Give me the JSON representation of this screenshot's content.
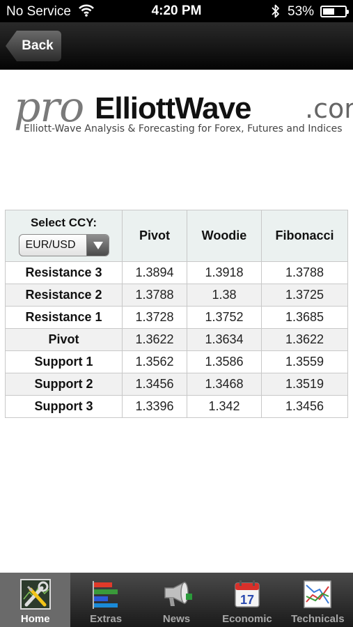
{
  "status_bar": {
    "carrier": "No Service",
    "time": "4:20 PM",
    "battery_percent": "53%",
    "battery_level": 0.53,
    "icons": [
      "wifi-icon",
      "bluetooth-icon",
      "battery-icon"
    ]
  },
  "nav": {
    "back_label": "Back"
  },
  "logo": {
    "pro": "pro",
    "brand": "ElliottWave",
    "dotcom": ".com",
    "tagline": "Elliott-Wave Analysis & Forecasting for Forex, Futures and Indices"
  },
  "table": {
    "select_label": "Select CCY:",
    "selected_ccy": "EUR/USD",
    "columns": [
      "Pivot",
      "Woodie",
      "Fibonacci"
    ],
    "rows": [
      {
        "label": "Resistance 3",
        "values": [
          "1.3894",
          "1.3918",
          "1.3788"
        ]
      },
      {
        "label": "Resistance 2",
        "values": [
          "1.3788",
          "1.38",
          "1.3725"
        ]
      },
      {
        "label": "Resistance 1",
        "values": [
          "1.3728",
          "1.3752",
          "1.3685"
        ]
      },
      {
        "label": "Pivot",
        "values": [
          "1.3622",
          "1.3634",
          "1.3622"
        ]
      },
      {
        "label": "Support 1",
        "values": [
          "1.3562",
          "1.3586",
          "1.3559"
        ]
      },
      {
        "label": "Support 2",
        "values": [
          "1.3456",
          "1.3468",
          "1.3519"
        ]
      },
      {
        "label": "Support 3",
        "values": [
          "1.3396",
          "1.342",
          "1.3456"
        ]
      }
    ]
  },
  "tabs": [
    {
      "label": "Home",
      "icon": "tools-icon",
      "active": true
    },
    {
      "label": "Extras",
      "icon": "bar-chart-icon",
      "active": false
    },
    {
      "label": "News",
      "icon": "megaphone-icon",
      "active": false
    },
    {
      "label": "Economic",
      "icon": "calendar-icon",
      "active": false
    },
    {
      "label": "Technicals",
      "icon": "line-chart-icon",
      "active": false
    }
  ],
  "calendar_day": "17",
  "colors": {
    "status_bar": "#000000",
    "header_cell": "#ebf1f0",
    "row_alt": "#f1f1f1",
    "tab_active": "#6a6a6a"
  }
}
